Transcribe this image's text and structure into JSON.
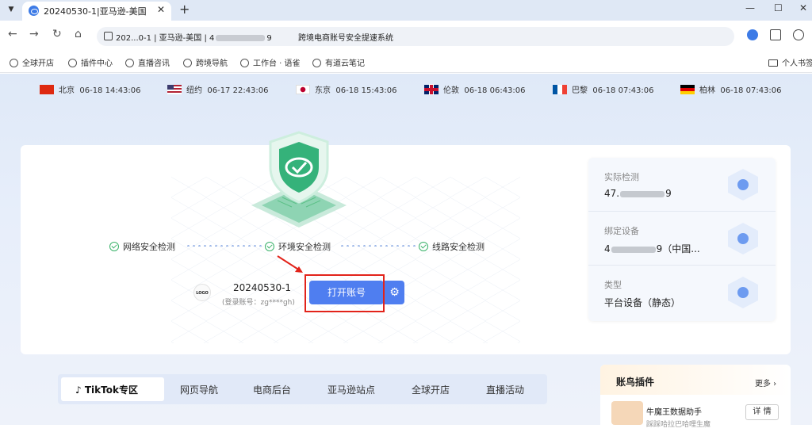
{
  "tab": {
    "title": "20240530-1|亚马逊-美国"
  },
  "omnibox": {
    "url_prefix": "202...0-1 | 亚马逊-美国 | 4",
    "url_suffix": "9",
    "page_title": "跨境电商账号安全提速系统"
  },
  "bookmarks": [
    "全球开店",
    "插件中心",
    "直播咨讯",
    "跨境导航",
    "工作台 · 语雀",
    "有道云笔记"
  ],
  "bookmarks_folder": "个人书签",
  "clocks": [
    {
      "city": "北京",
      "time": "06-18 14:43:06",
      "flag": "cn"
    },
    {
      "city": "纽约",
      "time": "06-17 22:43:06",
      "flag": "us"
    },
    {
      "city": "东京",
      "time": "06-18 15:43:06",
      "flag": "jp"
    },
    {
      "city": "伦敦",
      "time": "06-18 06:43:06",
      "flag": "gb"
    },
    {
      "city": "巴黎",
      "time": "06-18 07:43:06",
      "flag": "fr"
    },
    {
      "city": "柏林",
      "time": "06-18 07:43:06",
      "flag": "de"
    }
  ],
  "checks": [
    "网络安全检测",
    "环境安全检测",
    "线路安全检测"
  ],
  "account": {
    "logo_text": "LOGO",
    "name": "20240530-1",
    "login": "(登录账号：zg****gh)",
    "open_label": "打开账号"
  },
  "info": [
    {
      "label": "实际检测",
      "value_prefix": "47.",
      "value_suffix": "9"
    },
    {
      "label": "绑定设备",
      "value_prefix": "4",
      "value_suffix": "9（中国..."
    },
    {
      "label": "类型",
      "value_prefix": "平台设备（静态）",
      "value_suffix": ""
    }
  ],
  "tabs": [
    "TikTok专区",
    "网页导航",
    "电商后台",
    "亚马逊站点",
    "全球开店",
    "直播活动"
  ],
  "plugin": {
    "title": "账鸟插件",
    "more": "更多",
    "item_name": "牛魔王数据助手",
    "item_desc": "踩踩哈拉巴哈哩生魔",
    "detail": "详 情"
  },
  "colors": {
    "primary": "#4f7ef0",
    "highlight": "#e2231a",
    "success": "#3bb36a"
  }
}
